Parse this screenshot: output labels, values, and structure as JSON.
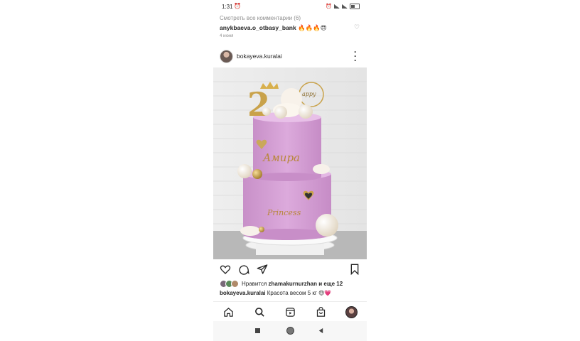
{
  "status_bar": {
    "time": "1:31",
    "alarm_icon": "alarm-icon"
  },
  "comments": {
    "view_all_label": "Смотреть все комментарии (6)",
    "top_comment": {
      "username": "anykbaeva.o_otbasy_bank",
      "text": "🔥🔥🔥😍"
    },
    "date": "4 июня"
  },
  "post": {
    "username": "bokayeva.kuralai",
    "likes": {
      "prefix": "Нравится",
      "username": "zhamakurnurzhan",
      "suffix": "и еще 12"
    },
    "caption": {
      "username": "bokayeva.kuralai",
      "text": "Красота весом 5 кг 😍💗"
    }
  },
  "photo": {
    "cake_name": "Amira",
    "topper_text": "Happy",
    "plate_text": "Princess",
    "number": "2"
  },
  "colors": {
    "cake_pink": "#d8a6d8",
    "gold": "#c9a24a"
  },
  "tabs": [
    "home-icon",
    "search-icon",
    "reels-icon",
    "shop-icon",
    "profile-icon"
  ]
}
